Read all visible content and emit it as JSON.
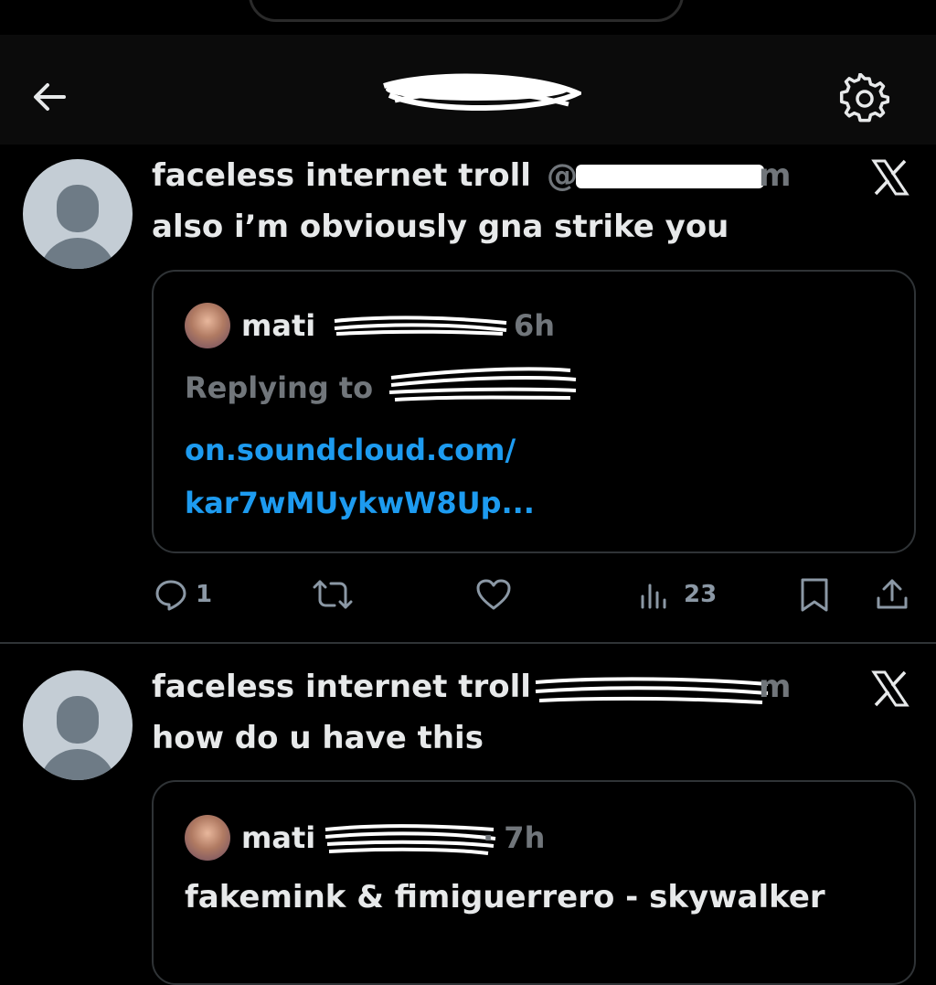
{
  "posts": [
    {
      "author": "faceless internet troll",
      "handle_stub": "@x",
      "time_stub": "m",
      "text": "also i’m obviously gna strike you",
      "quote": {
        "name": "mati",
        "time": "6h",
        "replying_to": "Replying to",
        "link_line1": "on.soundcloud.com/",
        "link_line2": "kar7wMUykwW8Up..."
      }
    },
    {
      "author": "faceless internet troll",
      "time_stub": "m",
      "text": "how do u have this",
      "quote": {
        "name": "mati",
        "time": "· 7h",
        "text": "fakemink & fimiguerrero - skywalker"
      }
    }
  ],
  "actions": {
    "reply_count": "1",
    "views_count": "23"
  },
  "icons": [
    "back-arrow-icon",
    "settings-gear-icon",
    "x-logo-icon",
    "reply-icon",
    "repost-icon",
    "like-icon",
    "views-icon",
    "bookmark-icon",
    "share-icon"
  ]
}
